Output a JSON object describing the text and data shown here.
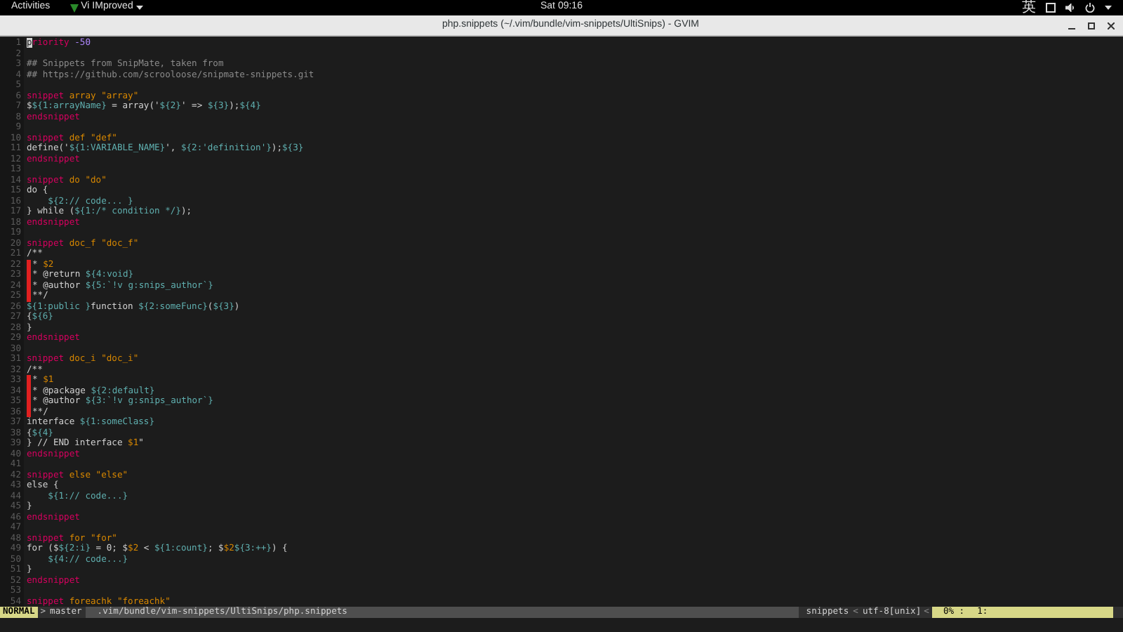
{
  "top_bar": {
    "activities": "Activities",
    "app_menu": "Vi IMproved",
    "clock": "Sat 09:16",
    "input_method": "英"
  },
  "window": {
    "title": "php.snippets (~/.vim/bundle/vim-snippets/UltiSnips) - GVIM"
  },
  "editor": {
    "lines": [
      {
        "number": "1",
        "marked": false,
        "tokens": [
          {
            "kind": "cursor",
            "text": "p"
          },
          {
            "kind": "keyword",
            "text": "riority"
          },
          {
            "kind": "number",
            "text": " -50"
          }
        ]
      },
      {
        "number": "2",
        "marked": false
      },
      {
        "number": "3",
        "marked": false,
        "tokens": [
          {
            "kind": "comment",
            "text": "## Snippets from SnipMate, taken from"
          }
        ]
      },
      {
        "number": "4",
        "marked": false,
        "tokens": [
          {
            "kind": "comment",
            "text": "## https://github.com/scrooloose/snipmate-snippets.git"
          }
        ]
      },
      {
        "number": "5",
        "marked": false
      },
      {
        "number": "6",
        "marked": false,
        "tokens": [
          {
            "kind": "keyword",
            "text": "snippet"
          },
          {
            "kind": "name",
            "text": " array \"array\""
          }
        ]
      },
      {
        "number": "7",
        "marked": false,
        "tokens": [
          {
            "kind": "text",
            "text": "$"
          },
          {
            "kind": "placeholder",
            "text": "${1:arrayName}"
          },
          {
            "kind": "text",
            "text": " = array('"
          },
          {
            "kind": "placeholder",
            "text": "${2}"
          },
          {
            "kind": "text",
            "text": "' => "
          },
          {
            "kind": "placeholder",
            "text": "${3}"
          },
          {
            "kind": "text",
            "text": ");"
          },
          {
            "kind": "placeholder",
            "text": "${4}"
          }
        ]
      },
      {
        "number": "8",
        "marked": false,
        "tokens": [
          {
            "kind": "keyword",
            "text": "endsnippet"
          }
        ]
      },
      {
        "number": "9",
        "marked": false
      },
      {
        "number": "10",
        "marked": false,
        "tokens": [
          {
            "kind": "keyword",
            "text": "snippet"
          },
          {
            "kind": "name",
            "text": " def \"def\""
          }
        ]
      },
      {
        "number": "11",
        "marked": false,
        "tokens": [
          {
            "kind": "text",
            "text": "define('"
          },
          {
            "kind": "placeholder",
            "text": "${1:VARIABLE_NAME}"
          },
          {
            "kind": "text",
            "text": "', "
          },
          {
            "kind": "placeholder",
            "text": "${2:'definition'}"
          },
          {
            "kind": "text",
            "text": ");"
          },
          {
            "kind": "placeholder",
            "text": "${3}"
          }
        ]
      },
      {
        "number": "12",
        "marked": false,
        "tokens": [
          {
            "kind": "keyword",
            "text": "endsnippet"
          }
        ]
      },
      {
        "number": "13",
        "marked": false
      },
      {
        "number": "14",
        "marked": false,
        "tokens": [
          {
            "kind": "keyword",
            "text": "snippet"
          },
          {
            "kind": "name",
            "text": " do \"do\""
          }
        ]
      },
      {
        "number": "15",
        "marked": false,
        "tokens": [
          {
            "kind": "text",
            "text": "do {"
          }
        ]
      },
      {
        "number": "16",
        "marked": false,
        "tokens": [
          {
            "kind": "placeholder",
            "text": "    ${2:// code... }"
          }
        ]
      },
      {
        "number": "17",
        "marked": false,
        "tokens": [
          {
            "kind": "text",
            "text": "} while ("
          },
          {
            "kind": "placeholder",
            "text": "${1:/* condition */}"
          },
          {
            "kind": "text",
            "text": ");"
          }
        ]
      },
      {
        "number": "18",
        "marked": false,
        "tokens": [
          {
            "kind": "keyword",
            "text": "endsnippet"
          }
        ]
      },
      {
        "number": "19",
        "marked": false
      },
      {
        "number": "20",
        "marked": false,
        "tokens": [
          {
            "kind": "keyword",
            "text": "snippet"
          },
          {
            "kind": "name",
            "text": " doc_f \"doc_f\""
          }
        ]
      },
      {
        "number": "21",
        "marked": false,
        "tokens": [
          {
            "kind": "text",
            "text": "/**"
          }
        ]
      },
      {
        "number": "22",
        "marked": true,
        "tokens": [
          {
            "kind": "text",
            "text": "* "
          },
          {
            "kind": "name",
            "text": "$2"
          }
        ]
      },
      {
        "number": "23",
        "marked": true,
        "tokens": [
          {
            "kind": "text",
            "text": "* @return "
          },
          {
            "kind": "placeholder",
            "text": "${4:void}"
          }
        ]
      },
      {
        "number": "24",
        "marked": true,
        "tokens": [
          {
            "kind": "text",
            "text": "* @author "
          },
          {
            "kind": "placeholder",
            "text": "${5:`!v g:snips_author`}"
          }
        ]
      },
      {
        "number": "25",
        "marked": true,
        "tokens": [
          {
            "kind": "text",
            "text": "**/"
          }
        ]
      },
      {
        "number": "26",
        "marked": false,
        "tokens": [
          {
            "kind": "placeholder",
            "text": "${1:public }"
          },
          {
            "kind": "text",
            "text": "function "
          },
          {
            "kind": "placeholder",
            "text": "${2:someFunc}"
          },
          {
            "kind": "text",
            "text": "("
          },
          {
            "kind": "placeholder",
            "text": "${3}"
          },
          {
            "kind": "text",
            "text": ")"
          }
        ]
      },
      {
        "number": "27",
        "marked": false,
        "tokens": [
          {
            "kind": "text",
            "text": "{"
          },
          {
            "kind": "placeholder",
            "text": "${6}"
          }
        ]
      },
      {
        "number": "28",
        "marked": false,
        "tokens": [
          {
            "kind": "text",
            "text": "}"
          }
        ]
      },
      {
        "number": "29",
        "marked": false,
        "tokens": [
          {
            "kind": "keyword",
            "text": "endsnippet"
          }
        ]
      },
      {
        "number": "30",
        "marked": false
      },
      {
        "number": "31",
        "marked": false,
        "tokens": [
          {
            "kind": "keyword",
            "text": "snippet"
          },
          {
            "kind": "name",
            "text": " doc_i \"doc_i\""
          }
        ]
      },
      {
        "number": "32",
        "marked": false,
        "tokens": [
          {
            "kind": "text",
            "text": "/**"
          }
        ]
      },
      {
        "number": "33",
        "marked": true,
        "tokens": [
          {
            "kind": "text",
            "text": "* "
          },
          {
            "kind": "name",
            "text": "$1"
          }
        ]
      },
      {
        "number": "34",
        "marked": true,
        "tokens": [
          {
            "kind": "text",
            "text": "* @package "
          },
          {
            "kind": "placeholder",
            "text": "${2:default}"
          }
        ]
      },
      {
        "number": "35",
        "marked": true,
        "tokens": [
          {
            "kind": "text",
            "text": "* @author "
          },
          {
            "kind": "placeholder",
            "text": "${3:`!v g:snips_author`}"
          }
        ]
      },
      {
        "number": "36",
        "marked": true,
        "tokens": [
          {
            "kind": "text",
            "text": "**/"
          }
        ]
      },
      {
        "number": "37",
        "marked": false,
        "tokens": [
          {
            "kind": "text",
            "text": "interface "
          },
          {
            "kind": "placeholder",
            "text": "${1:someClass}"
          }
        ]
      },
      {
        "number": "38",
        "marked": false,
        "tokens": [
          {
            "kind": "text",
            "text": "{"
          },
          {
            "kind": "placeholder",
            "text": "${4}"
          }
        ]
      },
      {
        "number": "39",
        "marked": false,
        "tokens": [
          {
            "kind": "text",
            "text": "} // END interface "
          },
          {
            "kind": "name",
            "text": "$1"
          },
          {
            "kind": "text",
            "text": "\""
          }
        ]
      },
      {
        "number": "40",
        "marked": false,
        "tokens": [
          {
            "kind": "keyword",
            "text": "endsnippet"
          }
        ]
      },
      {
        "number": "41",
        "marked": false
      },
      {
        "number": "42",
        "marked": false,
        "tokens": [
          {
            "kind": "keyword",
            "text": "snippet"
          },
          {
            "kind": "name",
            "text": " else \"else\""
          }
        ]
      },
      {
        "number": "43",
        "marked": false,
        "tokens": [
          {
            "kind": "text",
            "text": "else {"
          }
        ]
      },
      {
        "number": "44",
        "marked": false,
        "tokens": [
          {
            "kind": "placeholder",
            "text": "    ${1:// code...}"
          }
        ]
      },
      {
        "number": "45",
        "marked": false,
        "tokens": [
          {
            "kind": "text",
            "text": "}"
          }
        ]
      },
      {
        "number": "46",
        "marked": false,
        "tokens": [
          {
            "kind": "keyword",
            "text": "endsnippet"
          }
        ]
      },
      {
        "number": "47",
        "marked": false
      },
      {
        "number": "48",
        "marked": false,
        "tokens": [
          {
            "kind": "keyword",
            "text": "snippet"
          },
          {
            "kind": "name",
            "text": " for \"for\""
          }
        ]
      },
      {
        "number": "49",
        "marked": false,
        "tokens": [
          {
            "kind": "text",
            "text": "for ($"
          },
          {
            "kind": "placeholder",
            "text": "${2:i}"
          },
          {
            "kind": "text",
            "text": " = 0; $"
          },
          {
            "kind": "name",
            "text": "$2"
          },
          {
            "kind": "text",
            "text": " < "
          },
          {
            "kind": "placeholder",
            "text": "${1:count}"
          },
          {
            "kind": "text",
            "text": "; $"
          },
          {
            "kind": "name",
            "text": "$2"
          },
          {
            "kind": "placeholder",
            "text": "${3:++}"
          },
          {
            "kind": "text",
            "text": ") {"
          }
        ]
      },
      {
        "number": "50",
        "marked": false,
        "tokens": [
          {
            "kind": "placeholder",
            "text": "    ${4:// code...}"
          }
        ]
      },
      {
        "number": "51",
        "marked": false,
        "tokens": [
          {
            "kind": "text",
            "text": "}"
          }
        ]
      },
      {
        "number": "52",
        "marked": false,
        "tokens": [
          {
            "kind": "keyword",
            "text": "endsnippet"
          }
        ]
      },
      {
        "number": "53",
        "marked": false
      },
      {
        "number": "54",
        "marked": false,
        "tokens": [
          {
            "kind": "keyword",
            "text": "snippet"
          },
          {
            "kind": "name",
            "text": " foreachk \"foreachk\""
          }
        ]
      }
    ]
  },
  "status_line": {
    "mode": "NORMAL",
    "branch_separator": ">",
    "branch": "master",
    "path": ".vim/bundle/vim-snippets/UltiSnips/php.snippets",
    "filetype": "snippets",
    "separator_1": "<",
    "encoding": "utf-8[unix]",
    "separator_2": "<",
    "percent": "0% :",
    "position": "1:"
  }
}
